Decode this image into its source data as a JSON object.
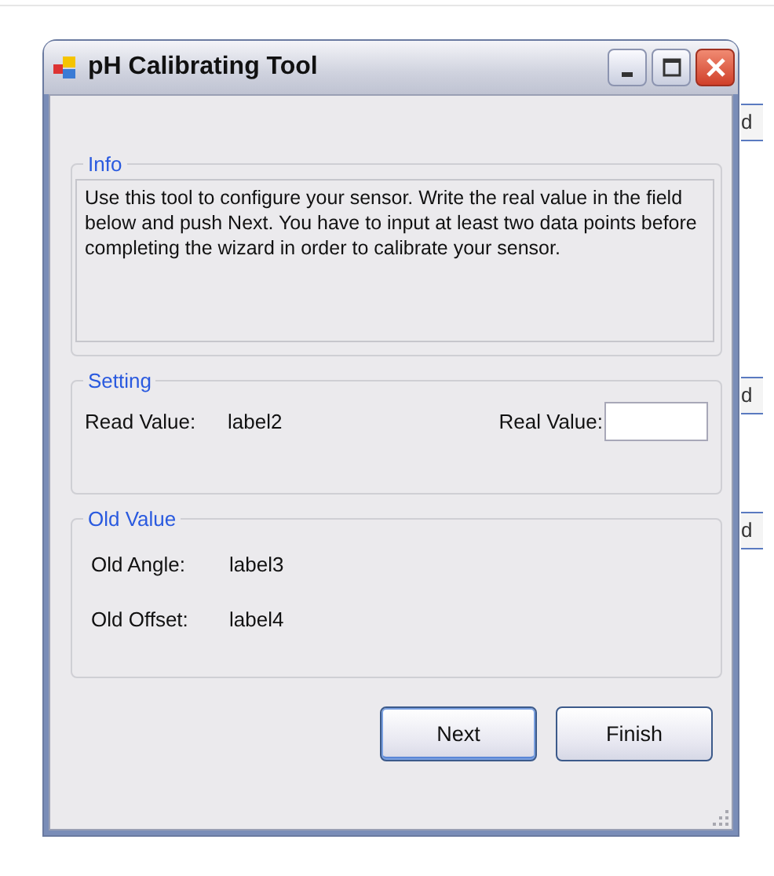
{
  "window": {
    "title": "pH Calibrating Tool"
  },
  "background_window": {
    "fragments": [
      "d",
      "d",
      "d"
    ]
  },
  "info": {
    "legend": "Info",
    "text": "Use this tool to configure your sensor. Write the real value in the field below and push Next. You have to input at least two data points before completing the wizard in order to calibrate your sensor."
  },
  "setting": {
    "legend": "Setting",
    "read_label": "Read Value:",
    "read_value": "label2",
    "real_label": "Real Value:"
  },
  "old_value": {
    "legend": "Old Value",
    "rows": [
      {
        "label": "Old Angle:",
        "value": "label3"
      },
      {
        "label": "Old Offset:",
        "value": "label4"
      }
    ]
  },
  "buttons": [
    {
      "label": "Next",
      "selected": true
    },
    {
      "label": "Finish",
      "selected": false
    }
  ]
}
